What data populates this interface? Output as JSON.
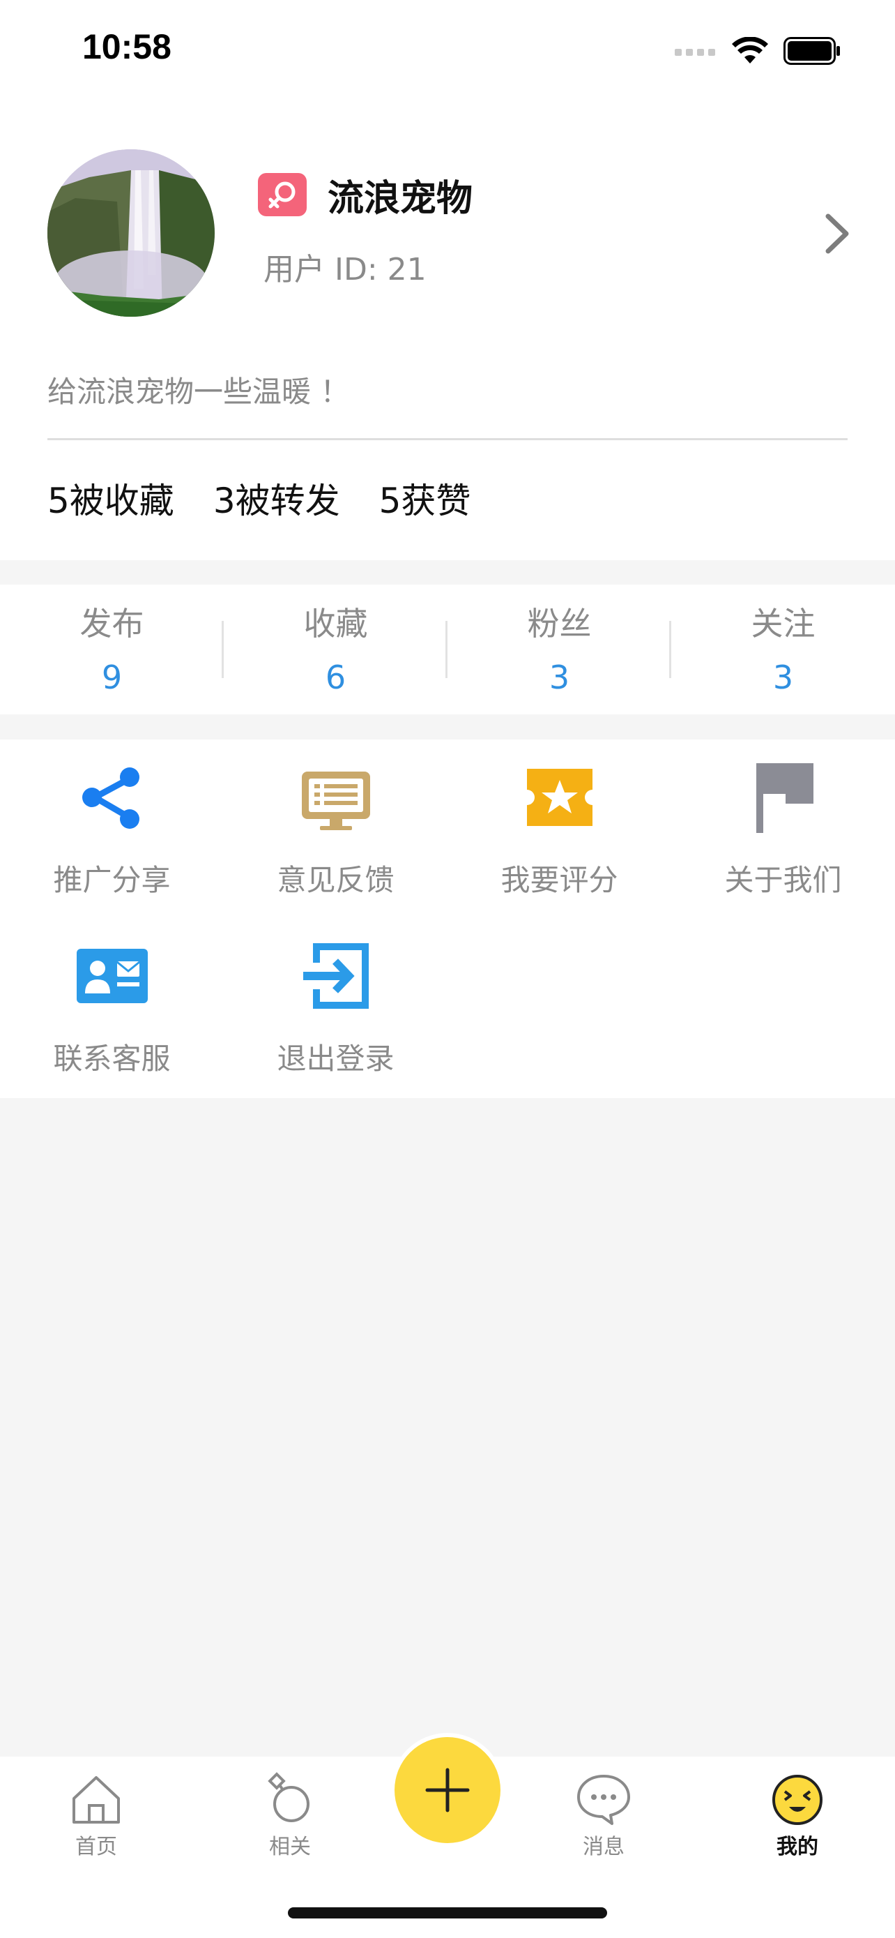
{
  "status_bar": {
    "time": "10:58"
  },
  "profile": {
    "avatar_icon": "waterfall-photo",
    "gender_icon": "female-icon",
    "username": "流浪宠物",
    "user_id": "用户 ID: 21",
    "bio": "给流浪宠物一些温暖 ！",
    "stats": [
      {
        "label": "5被收藏"
      },
      {
        "label": "3被转发"
      },
      {
        "label": "5获赞"
      }
    ]
  },
  "counters": [
    {
      "label": "发布",
      "value": "9"
    },
    {
      "label": "收藏",
      "value": "6"
    },
    {
      "label": "粉丝",
      "value": "3"
    },
    {
      "label": "关注",
      "value": "3"
    }
  ],
  "menu": [
    {
      "label": "推广分享",
      "icon": "share-icon",
      "color": "#1a7ef0"
    },
    {
      "label": "意见反馈",
      "icon": "feedback-board-icon",
      "color": "#c9a86a"
    },
    {
      "label": "我要评分",
      "icon": "rating-ticket-icon",
      "color": "#f5b014"
    },
    {
      "label": "关于我们",
      "icon": "flag-icon",
      "color": "#8b8c95"
    },
    {
      "label": "联系客服",
      "icon": "contact-card-icon",
      "color": "#2b9be8"
    },
    {
      "label": "退出登录",
      "icon": "logout-icon",
      "color": "#2b9be8"
    }
  ],
  "tabbar": {
    "tabs": [
      {
        "label": "首页",
        "icon": "home-icon"
      },
      {
        "label": "相关",
        "icon": "ring-icon"
      },
      {
        "label": "消息",
        "icon": "chat-bubble-icon"
      },
      {
        "label": "我的",
        "icon": "smiley-icon",
        "active": true
      }
    ],
    "fab_icon": "plus-icon",
    "accent": "#fcd93e"
  }
}
